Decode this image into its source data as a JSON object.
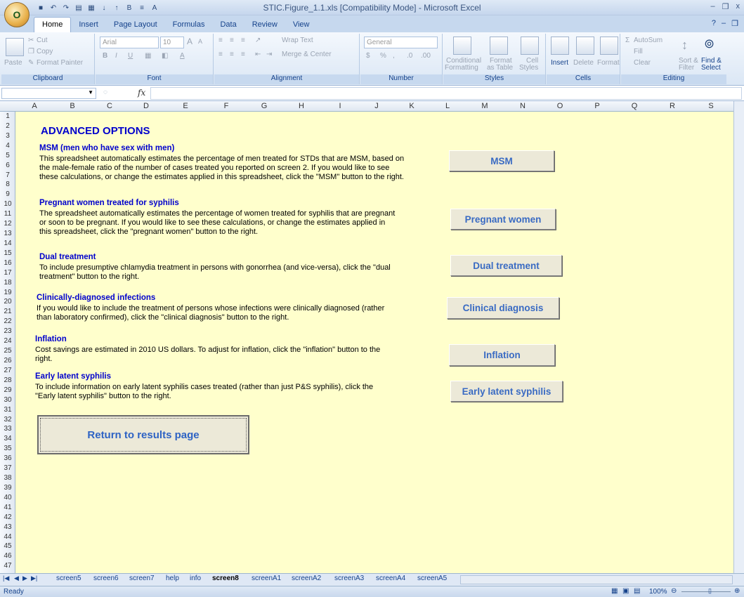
{
  "window": {
    "title": "STIC.Figure_1.1.xls  [Compatibility Mode] - Microsoft Excel",
    "office_button": "O",
    "min": "–",
    "restore": "❐",
    "close": "x"
  },
  "ribbon_tabs": [
    {
      "label": "Home"
    },
    {
      "label": "Insert"
    },
    {
      "label": "Page Layout"
    },
    {
      "label": "Formulas"
    },
    {
      "label": "Data"
    },
    {
      "label": "Review"
    },
    {
      "label": "View"
    }
  ],
  "clipboard": {
    "paste": "Paste",
    "cut": "Cut",
    "copy": "Copy",
    "format_painter": "Format Painter",
    "label": "Clipboard"
  },
  "font": {
    "name": "Arial",
    "size": "10",
    "label": "Font",
    "bold": "B",
    "italic": "I",
    "underline": "U",
    "grow": "A",
    "shrink": "A",
    "fill_icon": "paint-bucket-icon",
    "color": "A"
  },
  "alignment": {
    "wrap": "Wrap Text",
    "merge": "Merge & Center",
    "label": "Alignment"
  },
  "number": {
    "format": "General",
    "currency": "$",
    "percent": "%",
    "comma": ",",
    "label": "Number"
  },
  "styles": {
    "conditional": "Conditional",
    "conditional2": "Formatting",
    "format_table": "Format",
    "format_table2": "as Table",
    "cell_styles": "Cell",
    "cell_styles2": "Styles",
    "label": "Styles"
  },
  "cells": {
    "insert": "Insert",
    "delete": "Delete",
    "format": "Format",
    "label": "Cells"
  },
  "editing": {
    "autosum": "AutoSum",
    "fill": "Fill",
    "clear": "Clear",
    "sort": "Sort &",
    "sort2": "Filter",
    "find": "Find &",
    "find2": "Select",
    "label": "Editing"
  },
  "formula_bar": {
    "fx": "fx"
  },
  "columns": [
    "A",
    "B",
    "C",
    "D",
    "E",
    "F",
    "G",
    "H",
    "I",
    "J",
    "K",
    "L",
    "M",
    "N",
    "O",
    "P",
    "Q",
    "R",
    "S"
  ],
  "rows": [
    "1",
    "2",
    "3",
    "4",
    "5",
    "6",
    "7",
    "8",
    "9",
    "10",
    "11",
    "12",
    "13",
    "14",
    "15",
    "16",
    "17",
    "18",
    "19",
    "20",
    "21",
    "22",
    "23",
    "24",
    "25",
    "26",
    "27",
    "28",
    "29",
    "30",
    "31",
    "32",
    "33",
    "34",
    "35",
    "36",
    "37",
    "38",
    "39",
    "40",
    "41",
    "42",
    "43",
    "44",
    "45",
    "46",
    "47"
  ],
  "content": {
    "title": "ADVANCED OPTIONS",
    "sections": [
      {
        "heading": "MSM (men who have sex with men)",
        "lines": [
          "This spreadsheet automatically estimates the percentage of men treated for STDs that are MSM, based on",
          "the male-female ratio of the number of cases treated you reported on screen 2. If you would like to see",
          "these calculations, or change the estimates applied in this spreadsheet, click the \"MSM\" button to the right."
        ],
        "button": "MSM"
      },
      {
        "heading": "Pregnant women treated for syphilis",
        "lines": [
          "The spreadsheet automatically estimates the percentage of women treated for syphilis that are pregnant",
          "or soon to be pregnant.  If you would like to see these calculations, or change the estimates applied in",
          "this spreadsheet, click the \"pregnant women\" button to the right."
        ],
        "button": "Pregnant women"
      },
      {
        "heading": "Dual treatment",
        "lines": [
          "To include presumptive chlamydia treatment in persons with gonorrhea (and vice-versa), click the \"dual",
          "treatment\" button to the right."
        ],
        "button": "Dual treatment"
      },
      {
        "heading": "Clinically-diagnosed infections",
        "lines": [
          "If you would like to include the treatment of persons whose infections were clinically diagnosed (rather",
          "than laboratory confirmed), click the  \"clinical diagnosis\" button to the right."
        ],
        "button": "Clinical diagnosis"
      },
      {
        "heading": "Inflation",
        "lines": [
          "Cost savings are estimated in 2010 US dollars.  To adjust for inflation, click the \"inflation\" button to the",
          "right."
        ],
        "button": "Inflation"
      },
      {
        "heading": "Early latent syphilis",
        "lines": [
          "To include information on early latent syphilis cases treated (rather than just P&S syphilis), click the",
          "\"Early latent syphilis\" button to the right."
        ],
        "button": "Early latent syphilis"
      }
    ],
    "return_button": "Return to results page"
  },
  "sheet_tabs": [
    "screen5",
    "screen6",
    "screen7",
    "help",
    "info",
    "screen8",
    "screenA1",
    "screenA2",
    "screenA3",
    "screenA4",
    "screenA5"
  ],
  "active_sheet": "screen8",
  "status": {
    "ready": "Ready",
    "zoom": "100%"
  }
}
